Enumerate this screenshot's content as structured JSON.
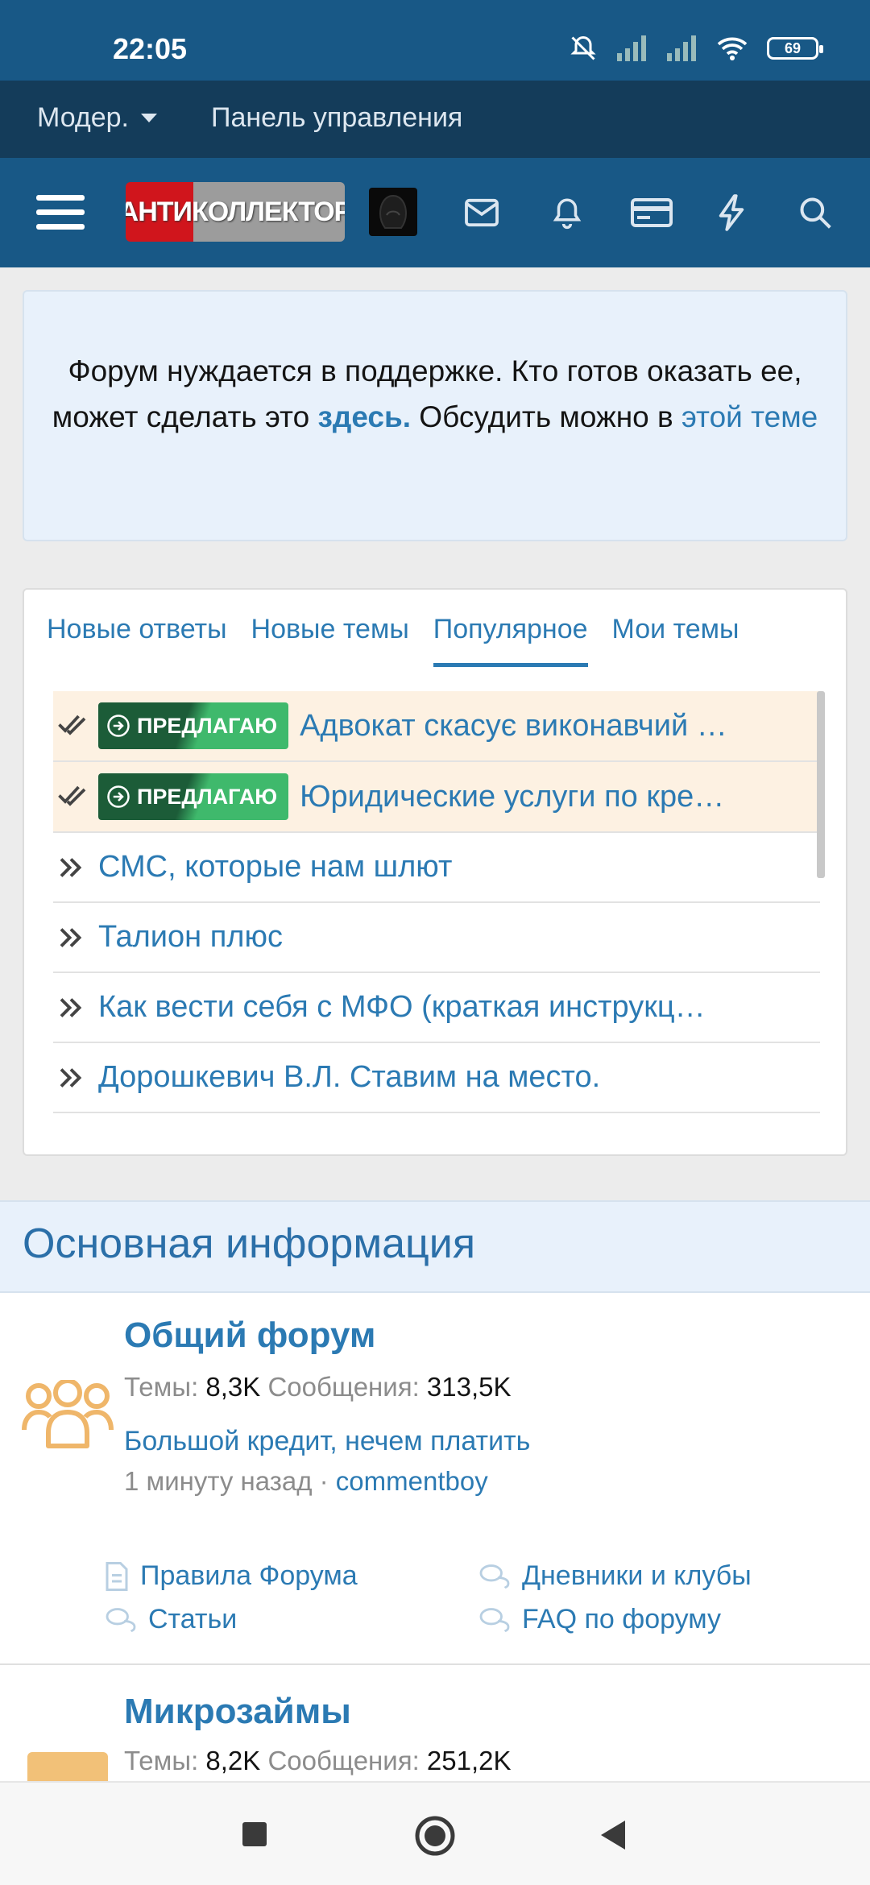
{
  "status_bar": {
    "time": "22:05",
    "battery": "69"
  },
  "mod_bar": {
    "dropdown_label": "Модер.",
    "panel_label": "Панель управления"
  },
  "header": {
    "logo_text": "АНТИКОЛЛЕКТОР"
  },
  "notice": {
    "text_1": "Форум нуждается в поддержке. Кто готов оказать ее, может сделать это ",
    "link_1": "здесь.",
    "text_2": " Обсудить можно в ",
    "link_2": "этой теме"
  },
  "tabs": [
    {
      "label": "Новые ответы"
    },
    {
      "label": "Новые темы"
    },
    {
      "label": "Популярное"
    },
    {
      "label": "Мои темы"
    }
  ],
  "threads": [
    {
      "badge": "ПРЕДЛАГАЮ",
      "title": "Адвокат скасує виконавчий …"
    },
    {
      "badge": "ПРЕДЛАГАЮ",
      "title": "Юридические услуги по кре…"
    },
    {
      "title": "СМС, которые нам шлют"
    },
    {
      "title": "Талион плюс"
    },
    {
      "title": "Как вести себя с МФО (краткая инструкц…"
    },
    {
      "title": "Дорошкевич В.Л. Ставим на место."
    }
  ],
  "section": {
    "title": "Основная информация"
  },
  "forum_1": {
    "title": "Общий форум",
    "threads_label": "Темы:",
    "threads_value": "8,3K",
    "posts_label": "Сообщения:",
    "posts_value": "313,5K",
    "last_post": "Большой кредит, нечем платить",
    "last_time": "1 минуту назад",
    "separator": " · ",
    "last_user": "commentboy",
    "subforums": [
      "Правила Форума",
      "Дневники и клубы",
      "Статьи",
      "FAQ по форуму"
    ]
  },
  "forum_2": {
    "title": "Микрозаймы",
    "threads_label": "Темы:",
    "threads_value": "8,2K",
    "posts_label": "Сообщения:",
    "posts_value": "251,2K"
  },
  "colors": {
    "header": "#185886",
    "mod_bar": "#143c5a",
    "link": "#2b7ab3",
    "badge": "#3fb96c"
  }
}
